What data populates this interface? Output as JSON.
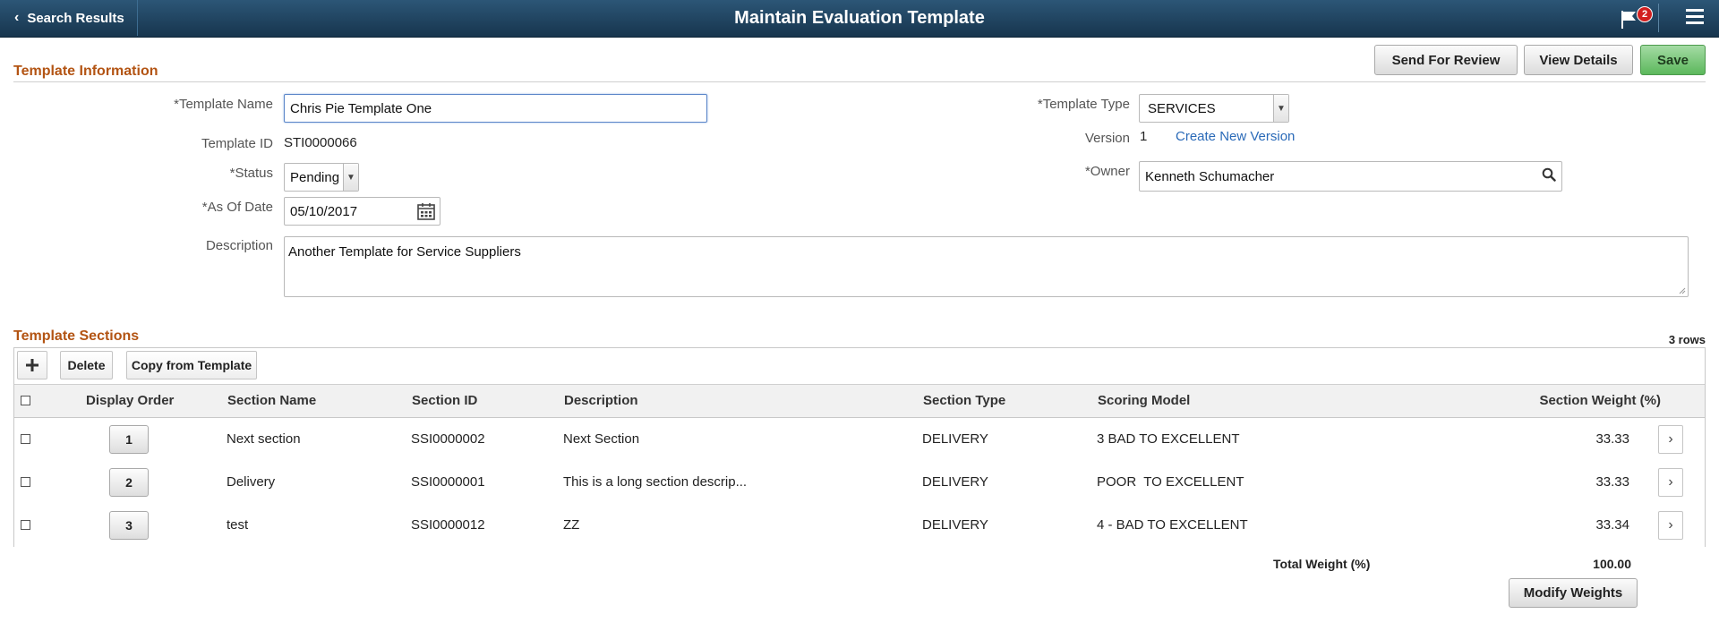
{
  "header": {
    "back_label": "Search Results",
    "title": "Maintain Evaluation Template",
    "notification_count": "2",
    "back_icon": "chevron-left-icon",
    "flag_icon": "flag-icon",
    "menu_icon": "hamburger-menu-icon"
  },
  "actions": {
    "send_for_review": "Send For Review",
    "view_details": "View Details",
    "save": "Save"
  },
  "template_info": {
    "section_title": "Template Information",
    "template_name_label": "*Template Name",
    "template_name": "Chris Pie Template One",
    "template_id_label": "Template ID",
    "template_id": "STI0000066",
    "status_label": "*Status",
    "status": "Pending",
    "as_of_date_label": "*As Of Date",
    "as_of_date": "05/10/2017",
    "description_label": "Description",
    "description": "Another Template for Service Suppliers",
    "template_type_label": "*Template Type",
    "template_type": "SERVICES",
    "version_label": "Version",
    "version": "1",
    "create_new_version": "Create New Version",
    "owner_label": "*Owner",
    "owner": "Kenneth Schumacher"
  },
  "sections": {
    "section_title": "Template Sections",
    "rows_count": "3 rows",
    "toolbar": {
      "add_icon": "plus-icon",
      "delete_label": "Delete",
      "copy_label": "Copy from Template"
    },
    "columns": {
      "display_order": "Display Order",
      "section_name": "Section Name",
      "section_id": "Section ID",
      "description": "Description",
      "section_type": "Section Type",
      "scoring_model": "Scoring Model",
      "section_weight": "Section Weight (%)"
    },
    "rows": [
      {
        "order": "1",
        "name": "Next section",
        "id": "SSI0000002",
        "description": "Next Section",
        "type": "DELIVERY",
        "scoring": "3 BAD TO EXCELLENT",
        "weight": "33.33"
      },
      {
        "order": "2",
        "name": "Delivery",
        "id": "SSI0000001",
        "description": "This is a long section descrip...",
        "type": "DELIVERY",
        "scoring": "POOR  TO EXCELLENT",
        "weight": "33.33"
      },
      {
        "order": "3",
        "name": "test",
        "id": "SSI0000012",
        "description": "ZZ",
        "type": "DELIVERY",
        "scoring": "4 - BAD TO EXCELLENT",
        "weight": "33.34"
      }
    ],
    "total_weight_label": "Total Weight (%)",
    "total_weight": "100.00",
    "modify_weights": "Modify Weights"
  },
  "colors": {
    "header_bg": "#1f4565",
    "section_title": "#b35413",
    "save_button": "#5cb85c",
    "link": "#2a6ab8",
    "notification_badge": "#d21f1f"
  }
}
